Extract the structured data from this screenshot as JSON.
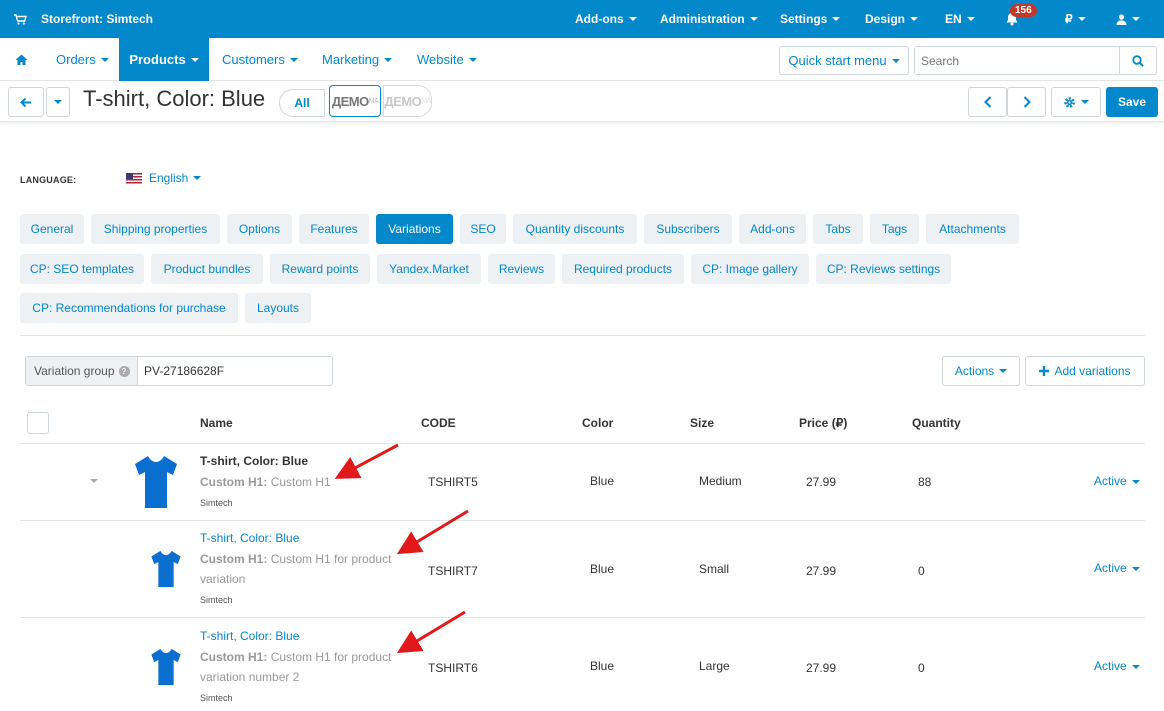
{
  "topbar": {
    "store": "Storefront: Simtech",
    "menus": [
      "Add-ons",
      "Administration",
      "Settings",
      "Design",
      "EN"
    ],
    "notifications": "156",
    "currency": "₽"
  },
  "nav": {
    "items": [
      "Orders",
      "Products",
      "Customers",
      "Marketing",
      "Website"
    ],
    "quick_start": "Quick start menu",
    "search_placeholder": "Search"
  },
  "toolbar": {
    "title": "T-shirt, Color: Blue",
    "all": "All",
    "demo": "ДЕМО",
    "demo_sup": "MA",
    "save": "Save"
  },
  "language": {
    "label": "LANGUAGE:",
    "value": "English"
  },
  "tabs": [
    "General",
    "Shipping properties",
    "Options",
    "Features",
    "Variations",
    "SEO",
    "Quantity discounts",
    "Subscribers",
    "Add-ons",
    "Tabs",
    "Tags",
    "Attachments",
    "CP: SEO templates",
    "Product bundles",
    "Reward points",
    "Yandex.Market",
    "Reviews",
    "Required products",
    "CP: Image gallery",
    "CP: Reviews settings",
    "CP: Recommendations for purchase",
    "Layouts"
  ],
  "variations": {
    "group_label": "Variation group",
    "group_value": "PV-27186628F",
    "actions": "Actions",
    "add": "Add variations",
    "headers": {
      "name": "Name",
      "code": "CODE",
      "color": "Color",
      "size": "Size",
      "price": "Price (₽)",
      "quantity": "Quantity"
    },
    "rows": [
      {
        "name": "T-shirt, Color: Blue",
        "h1_label": "Custom H1:",
        "h1_line1": "Custom H1",
        "h1_line2": "",
        "vendor": "Simtech",
        "code": "TSHIRT5",
        "color": "Blue",
        "size": "Medium",
        "price": "27.99",
        "quantity": "88",
        "status": "Active"
      },
      {
        "name": "T-shirt, Color: Blue",
        "h1_label": "Custom H1:",
        "h1_line1": "Custom H1 for product",
        "h1_line2": "variation",
        "vendor": "Simtech",
        "code": "TSHIRT7",
        "color": "Blue",
        "size": "Small",
        "price": "27.99",
        "quantity": "0",
        "status": "Active"
      },
      {
        "name": "T-shirt, Color: Blue",
        "h1_label": "Custom H1:",
        "h1_line1": "Custom H1 for product",
        "h1_line2": "variation number 2",
        "vendor": "Simtech",
        "code": "TSHIRT6",
        "color": "Blue",
        "size": "Large",
        "price": "27.99",
        "quantity": "0",
        "status": "Active"
      }
    ]
  },
  "colors": {
    "accent": "#0388cc",
    "arrow": "#e2191b",
    "tshirt": "#0a6fcf"
  }
}
